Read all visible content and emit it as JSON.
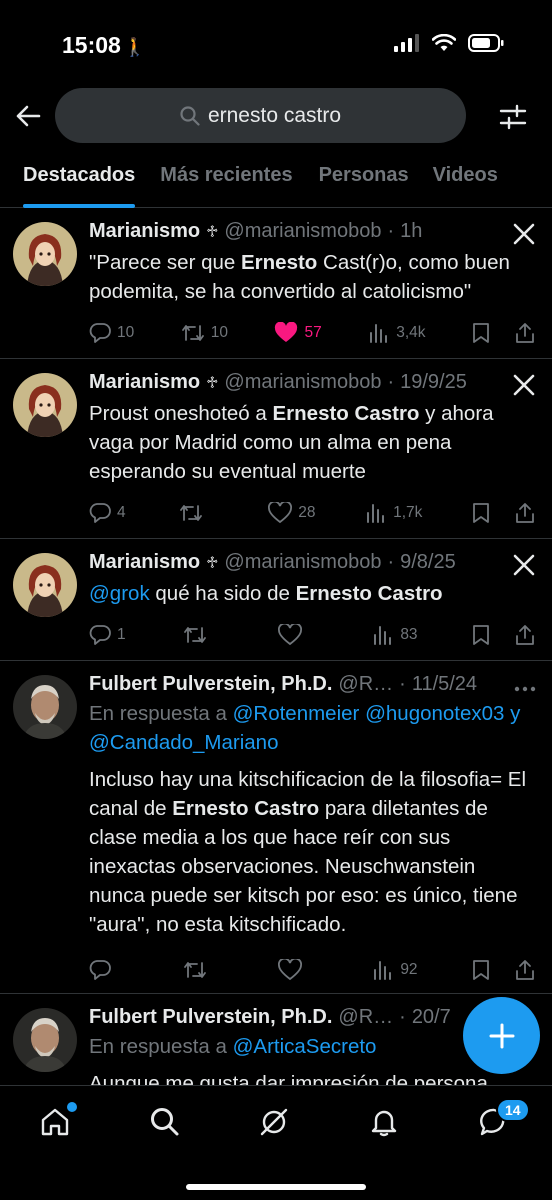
{
  "status_bar": {
    "time": "15:08",
    "person_glyph": "🚶"
  },
  "search": {
    "query": "ernesto castro"
  },
  "tabs": [
    "Destacados",
    "Más recientes",
    "Personas",
    "Videos"
  ],
  "tweets": [
    {
      "name": "Marianismo",
      "badge": "♱",
      "handle": "@marianismobob",
      "dot": "·",
      "date": "1h",
      "body_parts": [
        "\"Parece ser que ",
        "Ernesto",
        " Cast(r)o, como buen podemita, se ha convertido al catolicismo\""
      ],
      "replies": "10",
      "reposts": "10",
      "likes": "57",
      "views": "3,4k"
    },
    {
      "name": "Marianismo",
      "badge": "♱",
      "handle": "@marianismobob",
      "dot": "·",
      "date": "19/9/25",
      "body_parts": [
        "Proust oneshoteó a ",
        "Ernesto Castro",
        " y ahora vaga por Madrid como un alma en pena esperando su eventual muerte"
      ],
      "replies": "4",
      "reposts": "",
      "likes": "28",
      "views": "1,7k"
    },
    {
      "name": "Marianismo",
      "badge": "♱",
      "handle": "@marianismobob",
      "dot": "·",
      "date": "9/8/25",
      "mention": "@grok",
      "body_parts": [
        " qué ha sido de ",
        "Ernesto Castro",
        ""
      ],
      "replies": "1",
      "reposts": "",
      "likes": "",
      "views": "83"
    },
    {
      "name": "Fulbert Pulverstein, Ph.D.",
      "handle": "@R…",
      "dot": "·",
      "date": "11/5/24",
      "reply_label": "En respuesta a ",
      "reply_mentions": [
        "@Rotenmeier",
        "@hugonotex03",
        "y",
        "@Candado_Mariano"
      ],
      "body_parts": [
        "Incluso hay una kitschificacion de la filosofia= El canal de ",
        "Ernesto Castro",
        " para diletantes de clase media a los que hace reír con sus inexactas observaciones. Neuschwanstein nunca puede ser kitsch por eso: es único, tiene \"aura\", no esta kitschificado."
      ],
      "replies": "",
      "reposts": "",
      "likes": "",
      "views": "92"
    },
    {
      "name": "Fulbert Pulverstein, Ph.D.",
      "handle": "@R…",
      "dot": "·",
      "date": "20/7",
      "reply_label": "En respuesta a ",
      "reply_mentions": [
        "@ArticaSecreto"
      ],
      "body_parts": [
        "Aunque me gusta dar impresión de persona",
        "",
        ""
      ]
    }
  ],
  "bottom_nav": {
    "messages_badge": "14"
  },
  "colors": {
    "accent": "#1d9bf0",
    "like": "#f91880",
    "muted": "#71767b",
    "text": "#e7e9ea"
  }
}
